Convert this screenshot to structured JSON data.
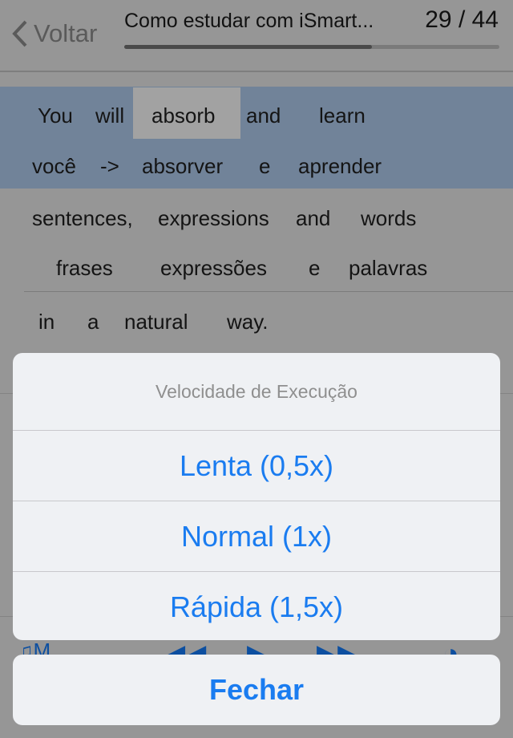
{
  "header": {
    "back_label": "Voltar",
    "title": "Como estudar com iSmart...",
    "counter": "29 / 44",
    "progress": 0.66
  },
  "lines": [
    {
      "words": [
        "You",
        "will",
        "absorb",
        "and",
        "learn"
      ],
      "highlighted_word": "absorb"
    },
    {
      "words": [
        "você",
        "->",
        "absorver",
        "e",
        "aprender"
      ]
    },
    {
      "words": [
        "sentences,",
        "expressions",
        "and",
        "words"
      ]
    },
    {
      "words": [
        "frases",
        "expressões",
        "e",
        "palavras"
      ]
    },
    {
      "words": [
        "in",
        "a",
        "natural",
        "way."
      ]
    }
  ],
  "toolbar": {
    "icons": [
      "headphones-icon",
      "rewind-icon",
      "play-icon",
      "fast-forward-icon",
      "timer-icon"
    ]
  },
  "action_sheet": {
    "title": "Velocidade de Execução",
    "options": [
      "Lenta (0,5x)",
      "Normal (1x)",
      "Rápida (1,5x)"
    ],
    "close_label": "Fechar"
  },
  "colors": {
    "accent": "#1a7cf0",
    "highlight_band": "#718399"
  }
}
